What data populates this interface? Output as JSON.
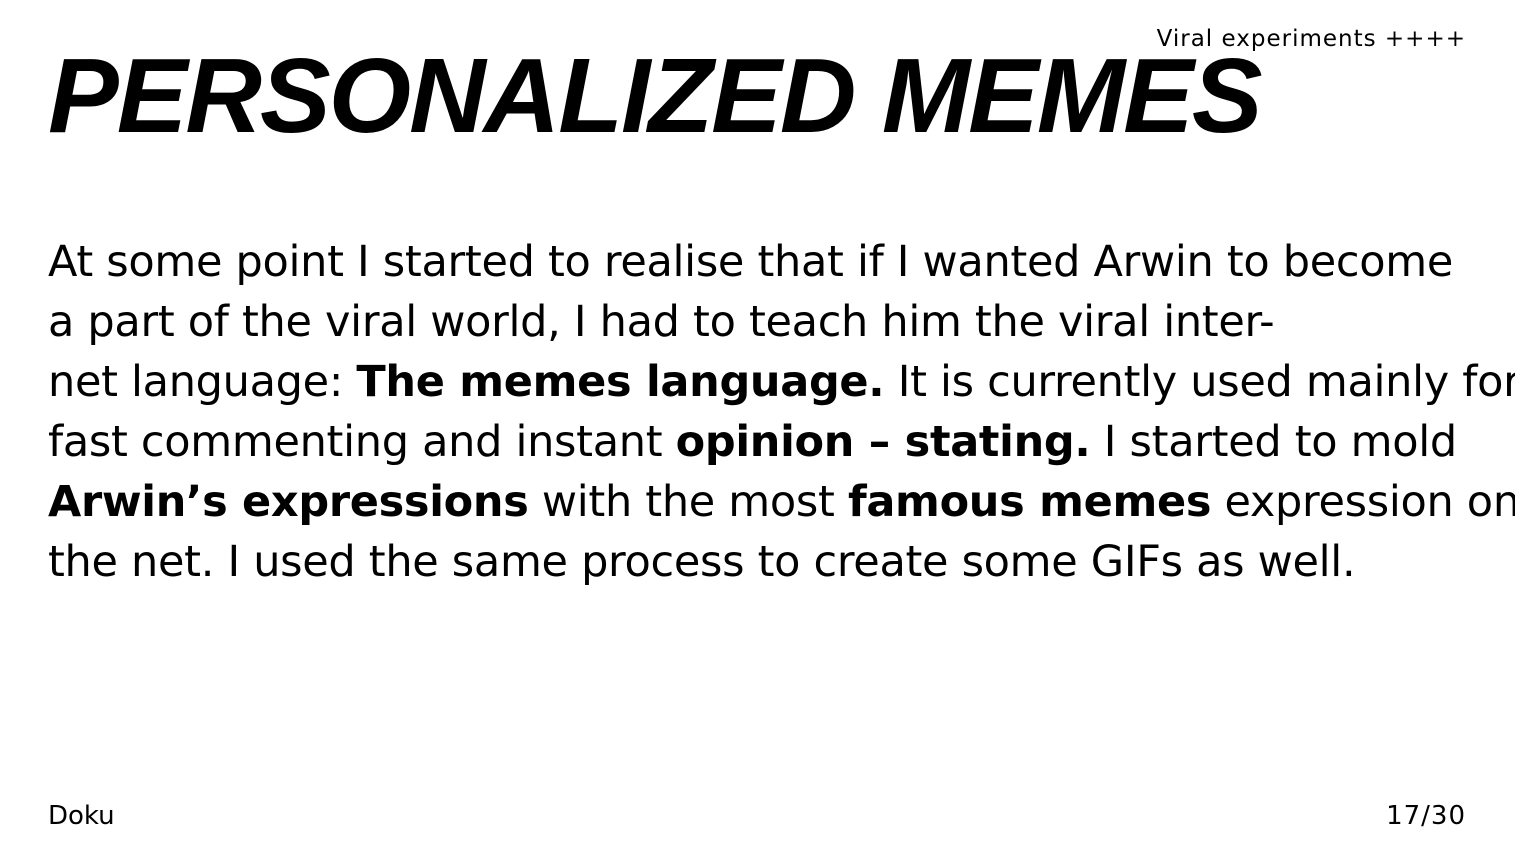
{
  "header": {
    "section_label": "Viral experiments ++++",
    "title": "PERSONALIZED MEMES"
  },
  "body": {
    "line1": "At some point I started to realise that if I wanted Arwin to become",
    "line2": "a part of the viral world, I had to teach him the viral inter-",
    "line3_a": "net language: ",
    "line3_bold": "The memes language.",
    "line3_b": " It is currently used mainly for",
    "line4_a": "fast commenting and instant ",
    "line4_bold": "opinion – stating.",
    "line4_b": " I started to mold",
    "line5_bold1": "Arwin’s expressions",
    "line5_a": " with the most ",
    "line5_bold2": "famous memes",
    "line5_b": " expression on",
    "line6": "the net. I used the same process to create some GIFs as well."
  },
  "footer": {
    "left": "Doku",
    "page": "17/30"
  }
}
